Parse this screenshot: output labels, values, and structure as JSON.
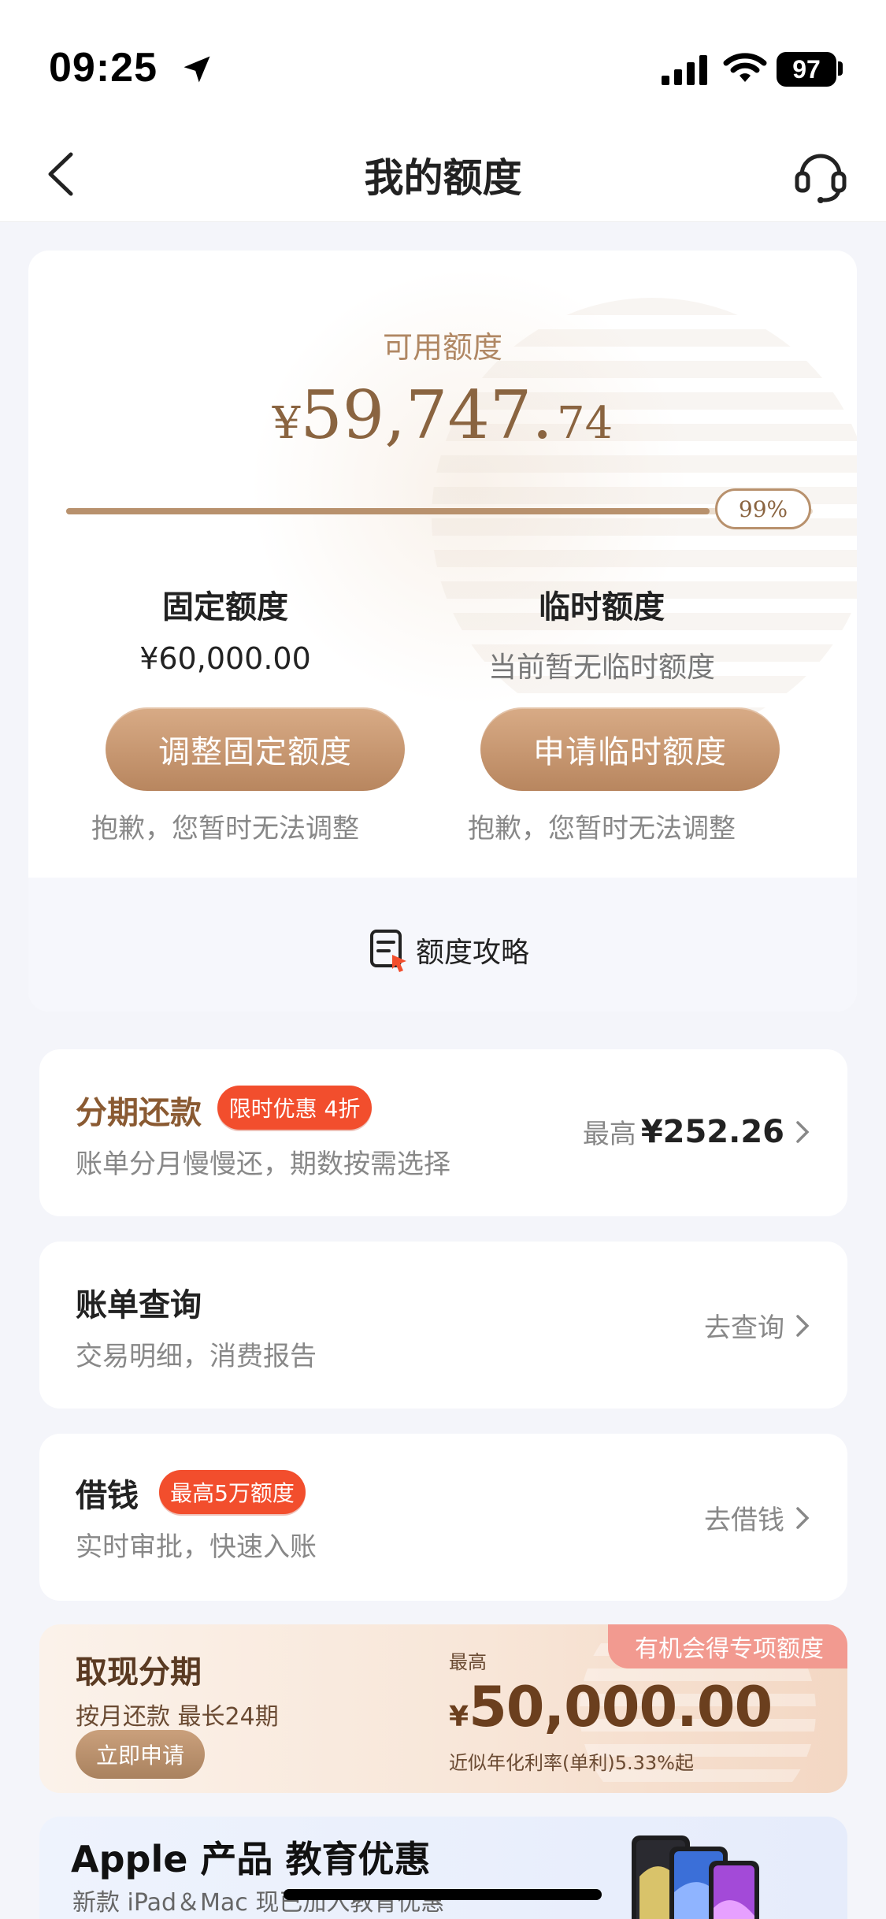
{
  "status_bar": {
    "time": "09:25",
    "battery": "97"
  },
  "nav": {
    "title": "我的额度"
  },
  "quota": {
    "available_label": "可用额度",
    "available_currency": "¥",
    "available_integer": "59,747.",
    "available_decimal": "74",
    "progress_percent": 99,
    "progress_label": "99%",
    "fixed": {
      "title": "固定额度",
      "value": "¥60,000.00",
      "button_label": "调整固定额度",
      "note": "抱歉，您暂时无法调整"
    },
    "temp": {
      "title": "临时额度",
      "value": "当前暂无临时额度",
      "button_label": "申请临时额度",
      "note": "抱歉，您暂时无法调整"
    },
    "guide_label": "额度攻略"
  },
  "installment": {
    "title": "分期还款",
    "tag": "限时优惠 4折",
    "desc": "账单分月慢慢还，期数按需选择",
    "right_prefix": "最高",
    "right_amount": "¥252.26"
  },
  "bill": {
    "title": "账单查询",
    "desc": "交易明细，消费报告",
    "action": "去查询"
  },
  "borrow": {
    "title": "借钱",
    "tag": "最高5万额度",
    "desc": "实时审批，快速入账",
    "action": "去借钱"
  },
  "cash": {
    "title": "取现分期",
    "sub": "按月还款 最长24期",
    "button": "立即申请",
    "max_label": "最高",
    "currency": "¥",
    "amount": "50,000.00",
    "rate": "近似年化利率(单利)5.33%起",
    "ribbon": "有机会得专项额度"
  },
  "promo": {
    "title": "Apple 产品 教育优惠",
    "sub": "新款 iPad＆Mac 现已加入教育优惠"
  },
  "colors": {
    "accent_gold": "#b8916d",
    "tag_red": "#f24e2d",
    "title_brown": "#8a5a32"
  }
}
